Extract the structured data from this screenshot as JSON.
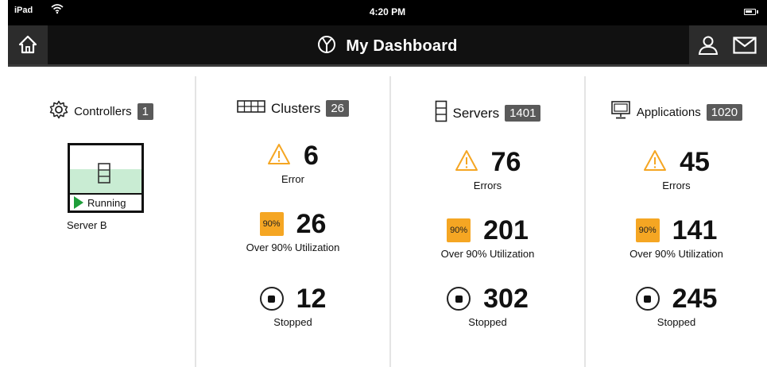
{
  "status_bar": {
    "carrier": "iPad",
    "time": "4:20 PM"
  },
  "header": {
    "title": "My Dashboard"
  },
  "controllers": {
    "label": "Controllers",
    "count": "1",
    "server": {
      "name": "Server B",
      "status": "Running"
    }
  },
  "clusters": {
    "label": "Clusters",
    "count": "26",
    "error_value": "6",
    "error_label": "Error",
    "util_badge": "90%",
    "util_value": "26",
    "util_label": "Over 90% Utilization",
    "stopped_value": "12",
    "stopped_label": "Stopped"
  },
  "servers": {
    "label": "Servers",
    "count": "1401",
    "error_value": "76",
    "error_label": "Errors",
    "util_badge": "90%",
    "util_value": "201",
    "util_label": "Over 90% Utilization",
    "stopped_value": "302",
    "stopped_label": "Stopped"
  },
  "applications": {
    "label": "Applications",
    "count": "1020",
    "error_value": "45",
    "error_label": "Errors",
    "util_badge": "90%",
    "util_value": "141",
    "util_label": "Over 90% Utilization",
    "stopped_value": "245",
    "stopped_label": "Stopped"
  },
  "colors": {
    "warning": "#f5a623",
    "running": "#1e9e3a",
    "running_bg": "#c9ecd3",
    "header": "#111111"
  },
  "icons": [
    "home-icon",
    "dashboard-icon",
    "user-icon",
    "mail-icon",
    "gear-icon",
    "grid-icon",
    "server-icon",
    "monitor-icon",
    "warning-icon",
    "stop-icon",
    "play-icon"
  ]
}
